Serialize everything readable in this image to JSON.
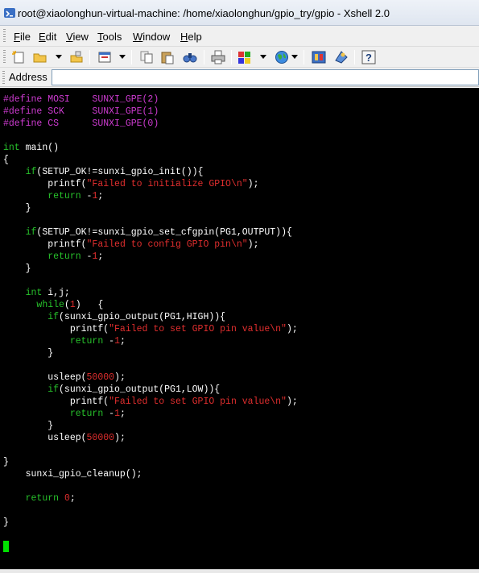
{
  "window": {
    "title": "root@xiaolonghun-virtual-machine: /home/xiaolonghun/gpio_try/gpio - Xshell 2.0"
  },
  "menu": [
    {
      "underline": "F",
      "rest": "ile"
    },
    {
      "underline": "E",
      "rest": "dit"
    },
    {
      "underline": "V",
      "rest": "iew"
    },
    {
      "underline": "T",
      "rest": "ools"
    },
    {
      "underline": "W",
      "rest": "indow"
    },
    {
      "underline": "H",
      "rest": "elp"
    }
  ],
  "toolbar_icons": [
    "new-session-icon",
    "open-folder-icon",
    "reconnect-icon",
    "properties-icon",
    "copy-icon",
    "paste-icon",
    "find-icon",
    "print-icon",
    "color-scheme-icon",
    "globe-icon",
    "file-transfer-icon",
    "keymap-icon",
    "help-icon"
  ],
  "address": {
    "label": "Address",
    "value": ""
  },
  "code_lines": [
    [
      {
        "t": "#define MOSI    SUNXI_GPE(2)",
        "c": "pp"
      }
    ],
    [
      {
        "t": "#define SCK     SUNXI_GPE(1)",
        "c": "pp"
      }
    ],
    [
      {
        "t": "#define CS      SUNXI_GPE(0)",
        "c": "pp"
      }
    ],
    [],
    [
      {
        "t": "int",
        "c": "kw"
      },
      {
        "t": " main()"
      }
    ],
    [
      {
        "t": "{"
      }
    ],
    [
      {
        "t": "    "
      },
      {
        "t": "if",
        "c": "kw"
      },
      {
        "t": "(SETUP_OK!=sunxi_gpio_init()){"
      }
    ],
    [
      {
        "t": "        printf("
      },
      {
        "t": "\"Failed to initialize GPIO\\n\"",
        "c": "str"
      },
      {
        "t": ");"
      }
    ],
    [
      {
        "t": "        "
      },
      {
        "t": "return",
        "c": "kw"
      },
      {
        "t": " -"
      },
      {
        "t": "1",
        "c": "num"
      },
      {
        "t": ";"
      }
    ],
    [
      {
        "t": "    }"
      }
    ],
    [],
    [
      {
        "t": "    "
      },
      {
        "t": "if",
        "c": "kw"
      },
      {
        "t": "(SETUP_OK!=sunxi_gpio_set_cfgpin(PG1,OUTPUT)){"
      }
    ],
    [
      {
        "t": "        printf("
      },
      {
        "t": "\"Failed to config GPIO pin\\n\"",
        "c": "str"
      },
      {
        "t": ");"
      }
    ],
    [
      {
        "t": "        "
      },
      {
        "t": "return",
        "c": "kw"
      },
      {
        "t": " -"
      },
      {
        "t": "1",
        "c": "num"
      },
      {
        "t": ";"
      }
    ],
    [
      {
        "t": "    }"
      }
    ],
    [],
    [
      {
        "t": "    "
      },
      {
        "t": "int",
        "c": "kw"
      },
      {
        "t": " i,j;"
      }
    ],
    [
      {
        "t": "      "
      },
      {
        "t": "while",
        "c": "kw"
      },
      {
        "t": "("
      },
      {
        "t": "1",
        "c": "num"
      },
      {
        "t": ")   {"
      }
    ],
    [
      {
        "t": "        "
      },
      {
        "t": "if",
        "c": "kw"
      },
      {
        "t": "(sunxi_gpio_output(PG1,HIGH)){"
      }
    ],
    [
      {
        "t": "            printf("
      },
      {
        "t": "\"Failed to set GPIO pin value\\n\"",
        "c": "str"
      },
      {
        "t": ");"
      }
    ],
    [
      {
        "t": "            "
      },
      {
        "t": "return",
        "c": "kw"
      },
      {
        "t": " -"
      },
      {
        "t": "1",
        "c": "num"
      },
      {
        "t": ";"
      }
    ],
    [
      {
        "t": "        }"
      }
    ],
    [],
    [
      {
        "t": "        usleep("
      },
      {
        "t": "50000",
        "c": "num"
      },
      {
        "t": ");"
      }
    ],
    [
      {
        "t": "        "
      },
      {
        "t": "if",
        "c": "kw"
      },
      {
        "t": "(sunxi_gpio_output(PG1,LOW)){"
      }
    ],
    [
      {
        "t": "            printf("
      },
      {
        "t": "\"Failed to set GPIO pin value\\n\"",
        "c": "str"
      },
      {
        "t": ");"
      }
    ],
    [
      {
        "t": "            "
      },
      {
        "t": "return",
        "c": "kw"
      },
      {
        "t": " -"
      },
      {
        "t": "1",
        "c": "num"
      },
      {
        "t": ";"
      }
    ],
    [
      {
        "t": "        }"
      }
    ],
    [
      {
        "t": "        usleep("
      },
      {
        "t": "50000",
        "c": "num"
      },
      {
        "t": ");"
      }
    ],
    [],
    [
      {
        "t": "}"
      }
    ],
    [
      {
        "t": "    sunxi_gpio_cleanup();"
      }
    ],
    [],
    [
      {
        "t": "    "
      },
      {
        "t": "return",
        "c": "kw"
      },
      {
        "t": " "
      },
      {
        "t": "0",
        "c": "num"
      },
      {
        "t": ";"
      }
    ],
    [],
    [
      {
        "t": "}"
      }
    ]
  ],
  "colors": {
    "preprocessor": "#cd3bd0",
    "keyword": "#27c12b",
    "string": "#e02e2e",
    "number": "#e02e2e",
    "text": "#ffffff",
    "background": "#000000",
    "cursor": "#00e000"
  }
}
